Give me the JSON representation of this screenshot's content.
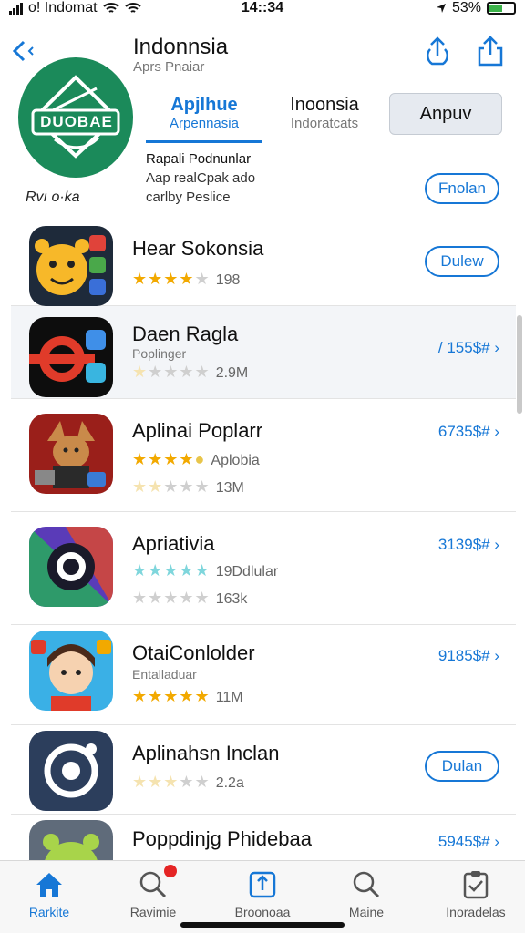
{
  "status_bar": {
    "carrier": "o! Indomat",
    "time": "14::34",
    "battery": "53%",
    "battery_level": 0.53
  },
  "header": {
    "title": "Indonnsia",
    "subtitle": "Aprs Pnaiar"
  },
  "logo": {
    "text": "DUOBAE",
    "caption": "Rvı o·ka"
  },
  "tabs": [
    {
      "label": "Apjlhue",
      "sub": "Arpennasia",
      "active": true
    },
    {
      "label": "Inoonsia",
      "sub": "Indoratcats",
      "active": false
    }
  ],
  "tab_button": "Anpuv",
  "description": {
    "line1": "Rapali Podnunlar",
    "line2": "Aap realCpak ado",
    "line3": "carlby Peslice"
  },
  "header_pill": "Fnolan",
  "apps": [
    {
      "name": "Hear Sokonsia",
      "sub": "",
      "stars": 4,
      "count": "198",
      "action_type": "button",
      "action": "Dulew"
    },
    {
      "name": "Daen Ragla",
      "sub": "Poplinger",
      "stars": 1,
      "count": "2.9M",
      "action_type": "price",
      "action": "/ 155$# ›"
    },
    {
      "name": "Aplinai Poplarr",
      "sub": "Aplobia",
      "stars": 4,
      "count": "13M",
      "action_type": "price",
      "action": "6735$# ›"
    },
    {
      "name": "Apriativia",
      "sub": "19Ddlular",
      "stars": 0,
      "count": "163k",
      "action_type": "price",
      "action": "3139$# ›"
    },
    {
      "name": "OtaiConlolder",
      "sub": "Entalladuar",
      "stars": 5,
      "count": "11M",
      "action_type": "price",
      "action": "9185$# ›"
    },
    {
      "name": "Aplinahsn Inclan",
      "sub": "",
      "stars": 2,
      "count": "2.2a",
      "action_type": "button",
      "action": "Dulan"
    },
    {
      "name": "Poppdinjg Phidebaa",
      "sub": "",
      "stars": 0,
      "count": "",
      "action_type": "price",
      "action": "5945$# ›"
    }
  ],
  "tabbar": [
    {
      "label": "Rarkite",
      "icon": "home-icon",
      "active": true
    },
    {
      "label": "Ravimie",
      "icon": "search-icon",
      "active": false,
      "badge": true
    },
    {
      "label": "Broonoaa",
      "icon": "share-icon",
      "active": false
    },
    {
      "label": "Maine",
      "icon": "search-icon",
      "active": false
    },
    {
      "label": "Inoradelas",
      "icon": "clipboard-icon",
      "active": false
    }
  ],
  "colors": {
    "accent": "#1677d6",
    "star": "#f2a900",
    "logo_bg": "#1b8a5a",
    "badge": "#e52525"
  }
}
